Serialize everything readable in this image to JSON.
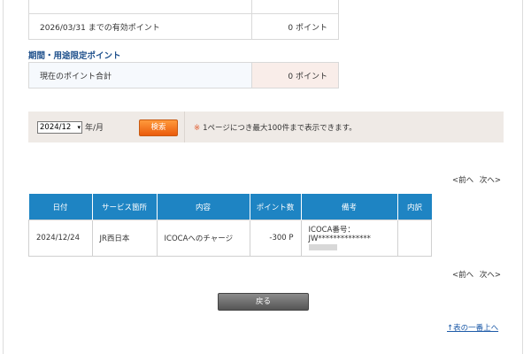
{
  "top_table": {
    "partial_label": "2026/03/31 までの有効ポイント",
    "row_label": "2026/03/31 までの有効ポイント",
    "row_value": "0 ポイント"
  },
  "limited": {
    "title": "期間・用途限定ポイント",
    "row_label": "現在のポイント合計",
    "row_value": "0 ポイント"
  },
  "search": {
    "month_value": "2024/12",
    "month_unit": "年/月",
    "button_label": "検索",
    "note_mark": "※",
    "note_text": "1ページにつき最大100件まで表示できます。"
  },
  "pager": {
    "prev": "<前へ",
    "next": "次へ>"
  },
  "history": {
    "headers": [
      "日付",
      "サービス箇所",
      "内容",
      "ポイント数",
      "備考",
      "内訳"
    ],
    "rows": [
      {
        "date": "2024/12/24",
        "service": "JR西日本",
        "content": "ICOCAへのチャージ",
        "points": "-300 P",
        "remark_label": "ICOCA番号：",
        "remark_value": "JW**************",
        "detail": ""
      }
    ]
  },
  "back_button": "戻る",
  "back_to_top": "↑表の一番上へ"
}
